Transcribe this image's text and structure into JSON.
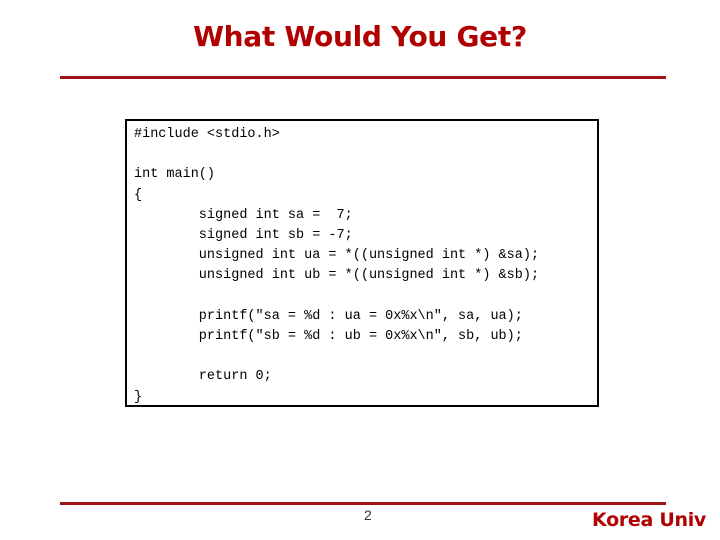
{
  "slide": {
    "title": "What Would You Get?",
    "page_number": "2",
    "organization": "Korea Univ",
    "accent_color": "#b00000"
  },
  "code": {
    "language": "c",
    "lines": [
      "#include <stdio.h>",
      "",
      "int main()",
      "{",
      "        signed int sa =  7;",
      "        signed int sb = -7;",
      "        unsigned int ua = *((unsigned int *) &sa);",
      "        unsigned int ub = *((unsigned int *) &sb);",
      "",
      "        printf(\"sa = %d : ua = 0x%x\\n\", sa, ua);",
      "        printf(\"sb = %d : ub = 0x%x\\n\", sb, ub);",
      "",
      "        return 0;",
      "}"
    ]
  }
}
